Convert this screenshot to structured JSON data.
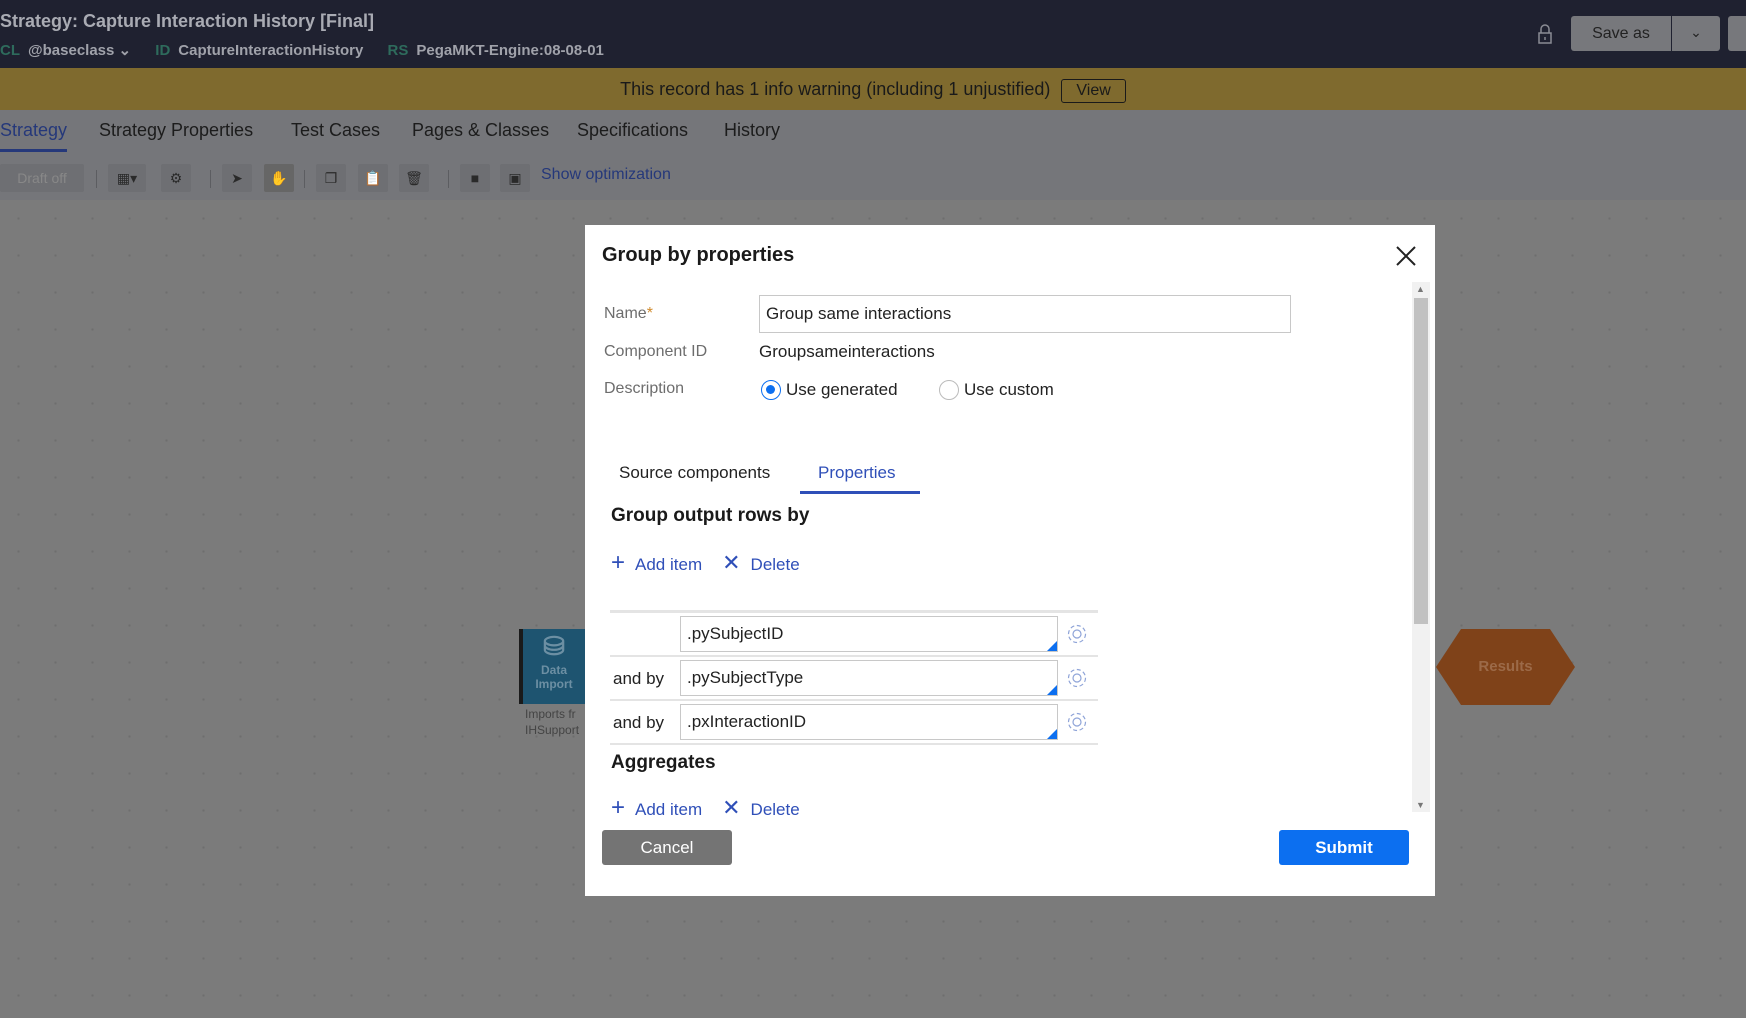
{
  "header": {
    "title": "Strategy: Capture Interaction History [Final]",
    "meta": [
      {
        "key": "CL",
        "value": "@baseclass"
      },
      {
        "key": "ID",
        "value": "CaptureInteractionHistory"
      },
      {
        "key": "RS",
        "value": "PegaMKT-Engine:08-08-01"
      }
    ],
    "save_as": "Save as"
  },
  "warning": {
    "text": "This record has 1 info warning (including 1 unjustified)",
    "view": "View",
    "color": "#7f6a2e"
  },
  "tabs": [
    "Strategy",
    "Strategy Properties",
    "Test Cases",
    "Pages & Classes",
    "Specifications",
    "History"
  ],
  "toolbar": {
    "draft": "Draft off",
    "show_optimization": "Show optimization"
  },
  "canvas": {
    "data_import": {
      "label1": "Data",
      "label2": "Import",
      "note1": "Imports fr",
      "note2": "IHSupport"
    },
    "results": "Results"
  },
  "modal": {
    "title": "Group by properties",
    "name_label": "Name",
    "name_required": "*",
    "name_value": "Group same interactions",
    "component_id_label": "Component ID",
    "component_id_value": "Groupsameinteractions",
    "description_label": "Description",
    "radio_generated": "Use generated",
    "radio_custom": "Use custom",
    "selected": "Use generated",
    "subtabs": [
      "Source components",
      "Properties"
    ],
    "active_subtab": "Properties",
    "group_heading": "Group output rows by",
    "add_item": "Add item",
    "delete": "Delete",
    "rows": [
      {
        "by": "",
        "value": ".pySubjectID"
      },
      {
        "by": "and by",
        "value": ".pySubjectType"
      },
      {
        "by": "and by",
        "value": ".pxInteractionID"
      }
    ],
    "aggregates_heading": "Aggregates",
    "cancel": "Cancel",
    "submit": "Submit",
    "accent": "#0c6ff0"
  }
}
